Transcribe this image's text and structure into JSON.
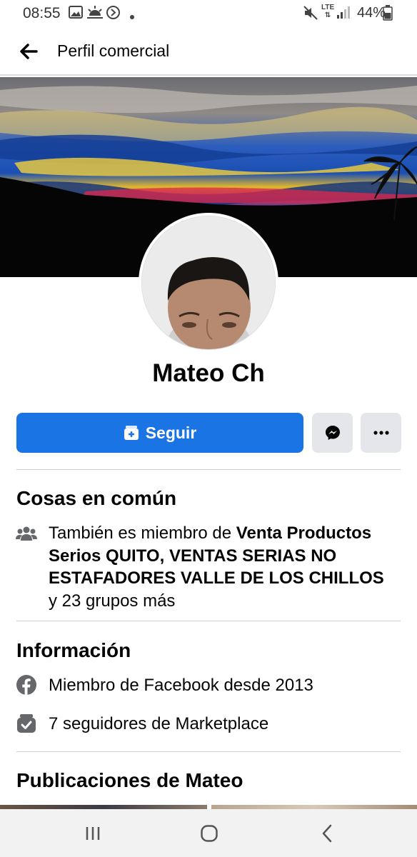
{
  "status_bar": {
    "time": "08:55",
    "battery": "44%",
    "network": "LTE",
    "icons": [
      "image-icon",
      "weather-icon",
      "sync-icon",
      "dot-icon",
      "mute-icon",
      "lte-icon",
      "signal-icon",
      "battery-icon"
    ]
  },
  "header": {
    "title": "Perfil comercial",
    "back_icon": "back-arrow-icon"
  },
  "profile": {
    "name": "Mateo Ch"
  },
  "actions": {
    "follow_label": "Seguir",
    "follow_color": "#1b74e4",
    "messenger_icon": "messenger-icon",
    "more_icon": "more-dots-icon"
  },
  "common": {
    "title": "Cosas en común",
    "groups_prefix": "También es miembro de ",
    "groups_names": "Venta Productos Serios QUITO, VENTAS SERIAS NO ESTAFADORES VALLE DE LOS CHILLOS",
    "groups_suffix": " y 23 grupos más"
  },
  "info": {
    "title": "Información",
    "member_since": "Miembro de Facebook desde 2013",
    "followers": "7 seguidores de Marketplace"
  },
  "posts": {
    "title": "Publicaciones de Mateo"
  },
  "nav": {
    "icons": [
      "recents-icon",
      "home-icon",
      "back-icon"
    ]
  }
}
